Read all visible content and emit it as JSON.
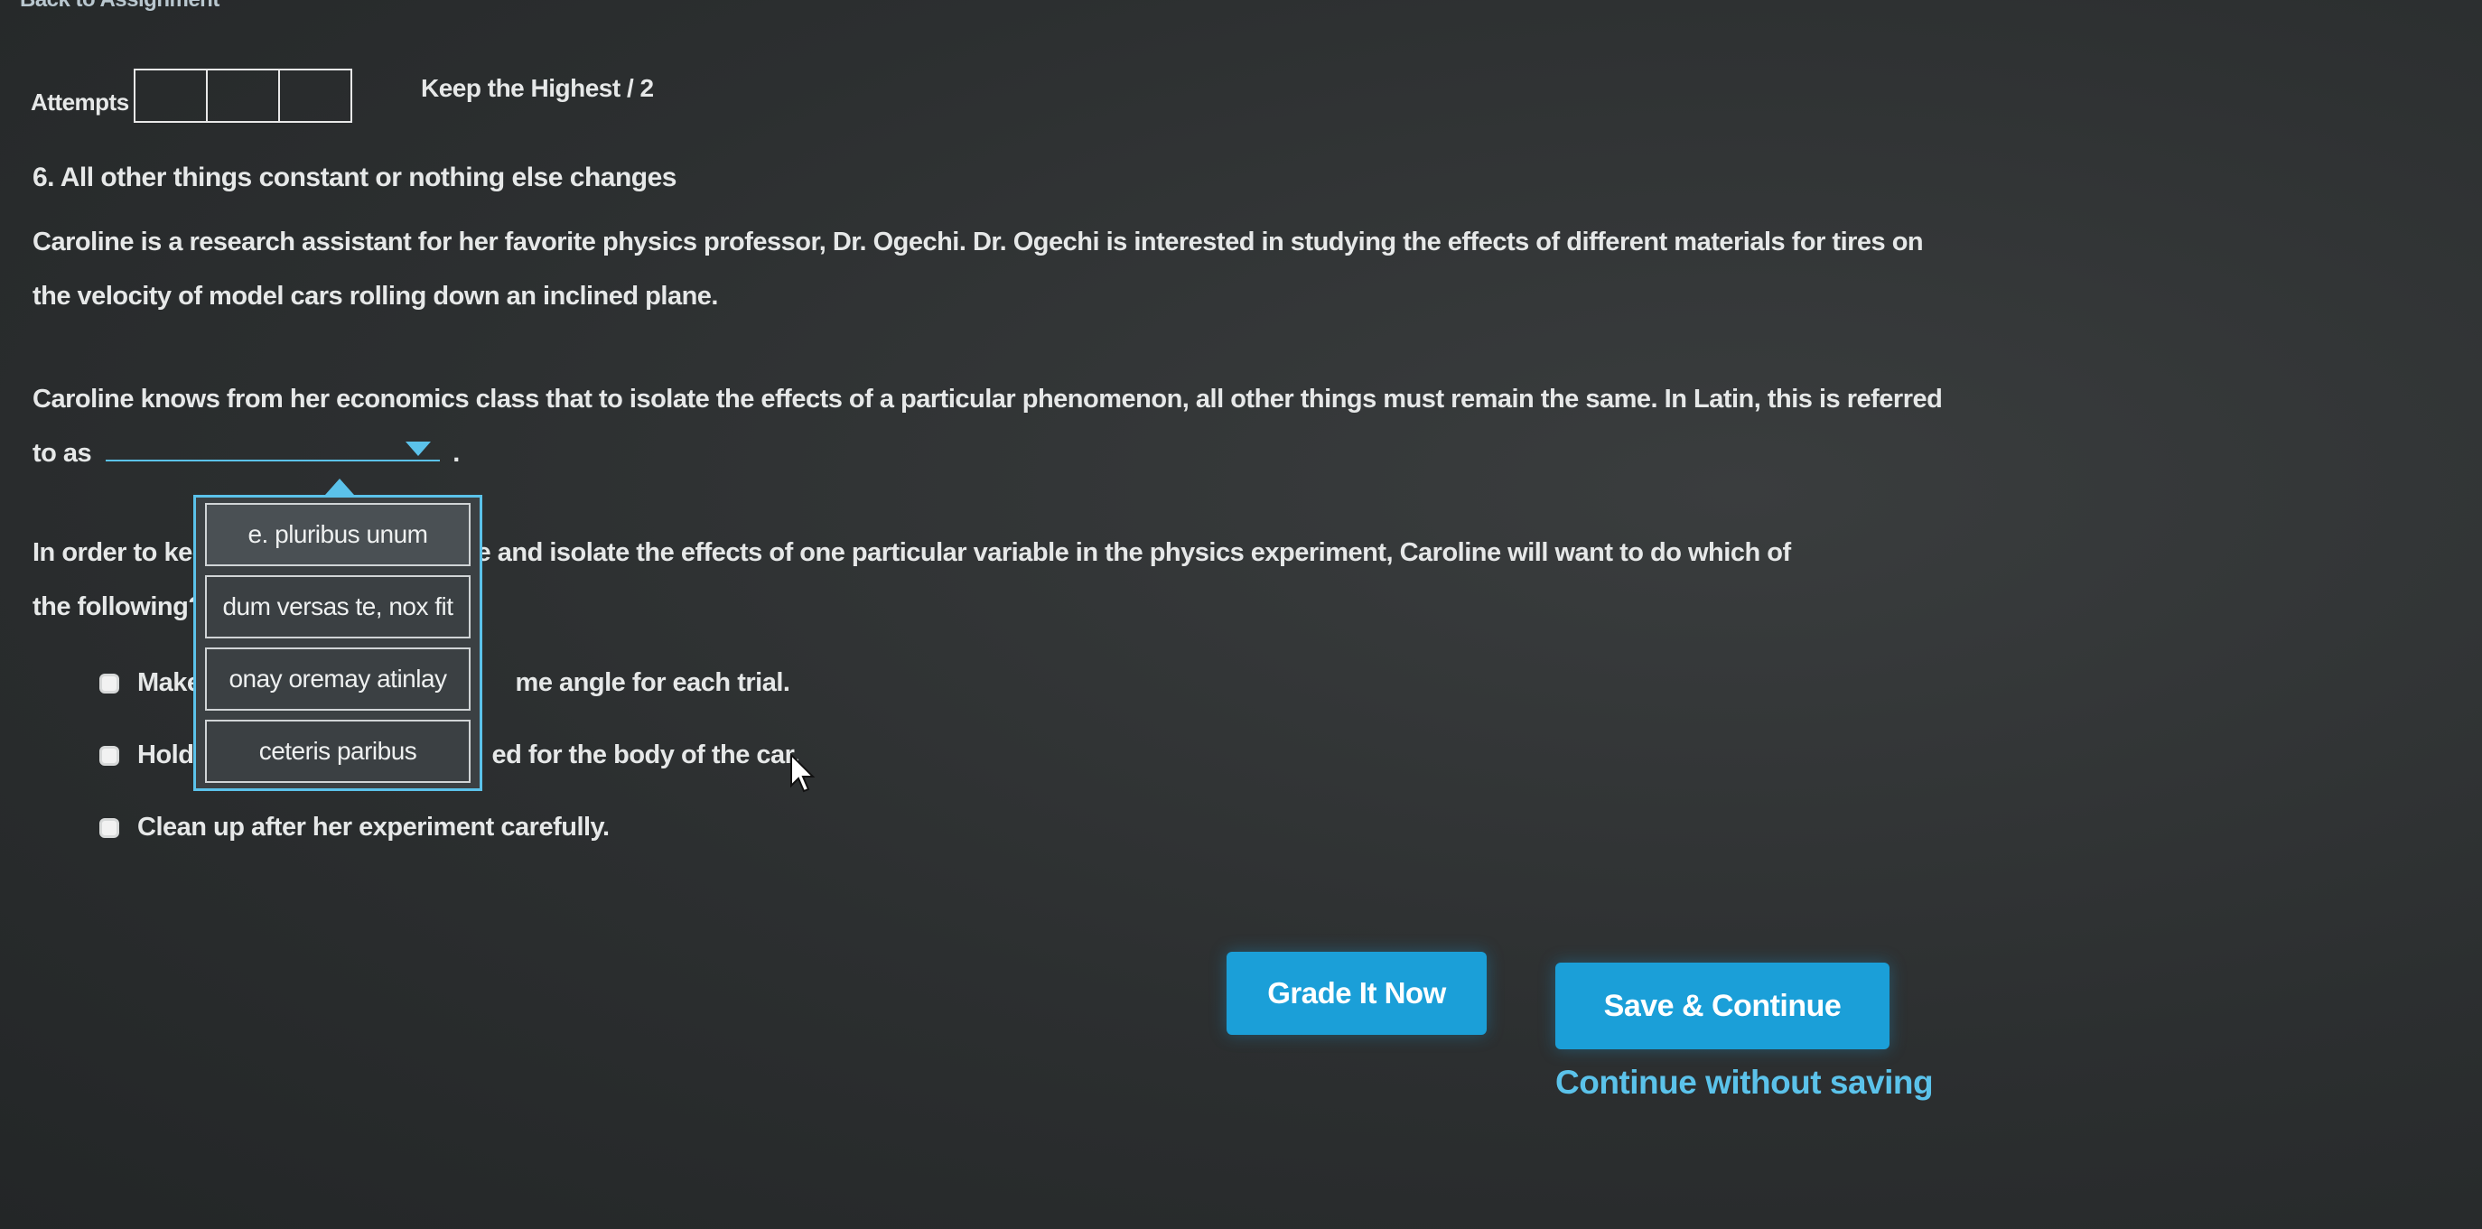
{
  "nav": {
    "back_label": "Back to Assignment"
  },
  "attempts": {
    "label": "Attempts",
    "keep_label": "Keep the Highest / 2"
  },
  "question": {
    "title": "6. All other things constant or nothing else changes",
    "para1": "Caroline is a research assistant for her favorite physics professor, Dr. Ogechi. Dr. Ogechi is interested in studying the effects of different materials for tires on the velocity of model cars rolling down an inclined plane.",
    "para2_before": "Caroline knows from her economics class that to isolate the effects of a particular phenomenon, all other things must remain the same. In Latin, this is referred to as",
    "para2_after": ".",
    "para3_left1": "In order to kee",
    "para3_right1": "ne and isolate the effects of one particular variable in the physics experiment, Caroline will want to do which of",
    "para3_left2": "the following? (",
    "options": [
      {
        "left": "Make",
        "right": "me angle for each trial."
      },
      {
        "left": "Hold",
        "right": "ed for the body of the car."
      },
      {
        "left": "Clean up after her experiment carefully.",
        "right": ""
      }
    ]
  },
  "dropdown": {
    "items": [
      "e. pluribus unum",
      "dum versas te, nox fit",
      "onay oremay atinlay",
      "ceteris paribus"
    ]
  },
  "actions": {
    "grade_label": "Grade It Now",
    "save_label": "Save & Continue",
    "continue_label": "Continue without saving"
  },
  "colors": {
    "accent": "#1b9fd8",
    "link": "#5bc2ea"
  }
}
